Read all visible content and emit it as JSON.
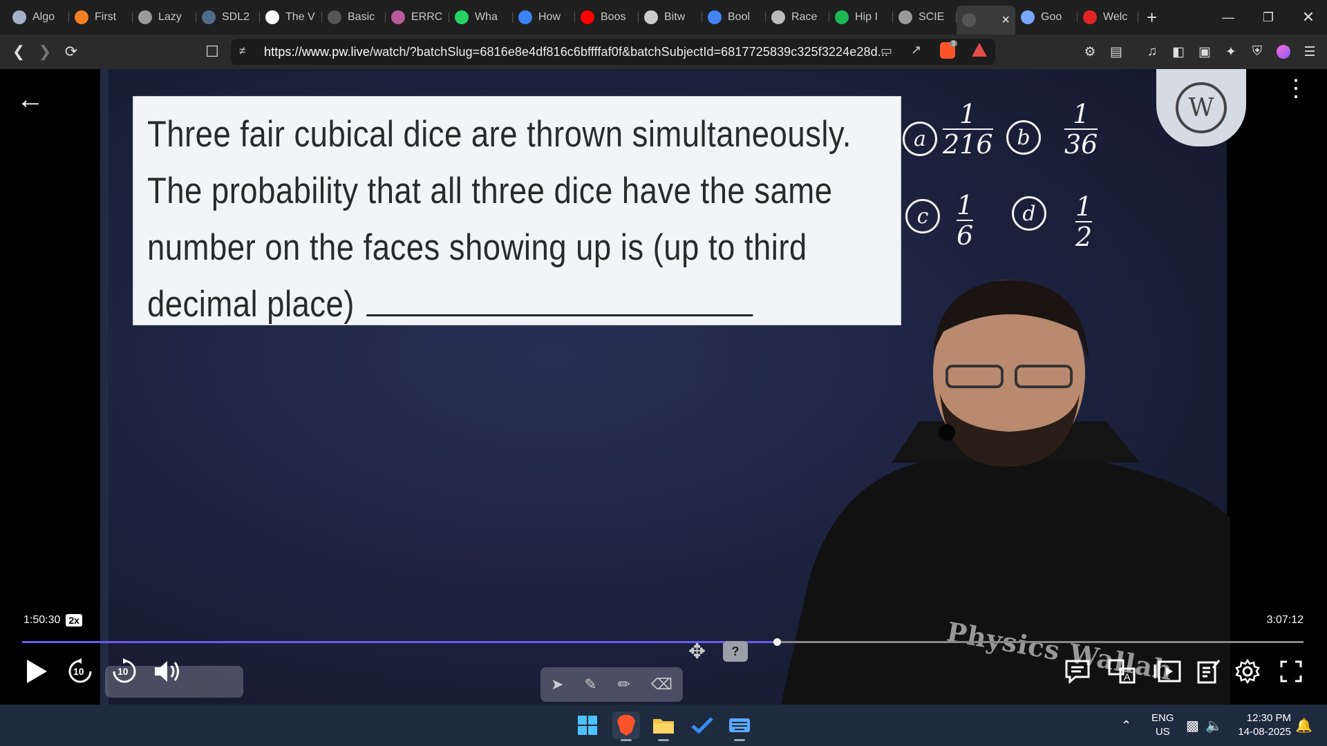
{
  "browser": {
    "tabs": [
      {
        "label": "Algo",
        "icon": "chatgpt-icon",
        "color": "#a6b2c8"
      },
      {
        "label": "First",
        "icon": "stackoverflow-icon",
        "color": "#f48024"
      },
      {
        "label": "Lazy",
        "icon": "globe-icon",
        "color": "#9a9a9a"
      },
      {
        "label": "SDL2",
        "icon": "sdl-icon",
        "color": "#4f6b8a"
      },
      {
        "label": "The V",
        "icon": "w3schools-icon",
        "color": "#ffffff"
      },
      {
        "label": "Basic",
        "icon": "cpp-icon",
        "color": "#555555"
      },
      {
        "label": "ERRC",
        "icon": "brain-icon",
        "color": "#b65a9a"
      },
      {
        "label": "Wha",
        "icon": "whatsapp-icon",
        "color": "#25d366"
      },
      {
        "label": "How",
        "icon": "bookmark-icon",
        "color": "#3b82f6"
      },
      {
        "label": "Boos",
        "icon": "youtube-icon",
        "color": "#ff0000"
      },
      {
        "label": "Bitw",
        "icon": "orkg-icon",
        "color": "#cccccc"
      },
      {
        "label": "Bool",
        "icon": "google-icon",
        "color": "#4285f4"
      },
      {
        "label": "Race",
        "icon": "openai-icon",
        "color": "#bbbbbb"
      },
      {
        "label": "Hip I",
        "icon": "spotify-icon",
        "color": "#1db954"
      },
      {
        "label": "SCIE",
        "icon": "globe-icon",
        "color": "#9a9a9a"
      },
      {
        "label": "",
        "icon": "pw-icon",
        "color": "#555555",
        "active": true
      },
      {
        "label": "Goo",
        "icon": "gemini-icon",
        "color": "#7aa7ff"
      },
      {
        "label": "Welc",
        "icon": "c-logo-icon",
        "color": "#e02424"
      }
    ],
    "url_host": "https://www.pw.live",
    "url_rest": "/watch/?batchSlug=6816e8e4df816c6bffffaf0f&batchSubjectId=6817725839c325f3224e28d...",
    "brave_badge": "3"
  },
  "video": {
    "question_lines": [
      "Three fair cubical dice are thrown simultaneously.",
      "The probability that all three dice have the same",
      "number on the faces showing up is (up to third",
      "decimal place)"
    ],
    "options": [
      {
        "label": "a",
        "num": "1",
        "den": "216"
      },
      {
        "label": "b",
        "num": "1",
        "den": "36"
      },
      {
        "label": "c",
        "num": "1",
        "den": "6"
      },
      {
        "label": "d",
        "num": "1",
        "den": "2"
      }
    ],
    "logo_text": "W",
    "watermark": "Physics Wallah",
    "current_time": "1:50:30",
    "speed": "2x",
    "total_time": "3:07:12",
    "progress_fraction": 0.589,
    "seek_back": "10",
    "seek_forward": "10",
    "help": "?"
  },
  "taskbar": {
    "lang_top": "ENG",
    "lang_bottom": "US",
    "time": "12:30 PM",
    "date": "14-08-2025"
  }
}
